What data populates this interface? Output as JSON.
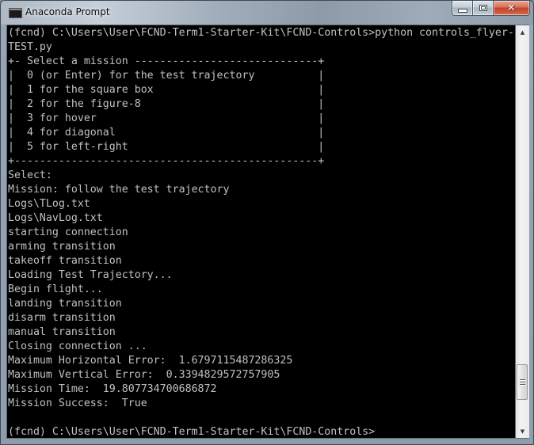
{
  "window": {
    "title": "Anaconda Prompt",
    "icon": "console-icon",
    "buttons": {
      "minimize": "minimize",
      "maximize": "maximize",
      "close": "close",
      "close_glyph": "✕"
    }
  },
  "console": {
    "lines": [
      "(fcnd) C:\\Users\\User\\FCND-Term1-Starter-Kit\\FCND-Controls>python controls_flyer-",
      "TEST.py",
      "+- Select a mission -----------------------------+",
      "|  0 (or Enter) for the test trajectory          |",
      "|  1 for the square box                          |",
      "|  2 for the figure-8                            |",
      "|  3 for hover                                   |",
      "|  4 for diagonal                                |",
      "|  5 for left-right                              |",
      "+------------------------------------------------+",
      "Select:",
      "Mission: follow the test trajectory",
      "Logs\\TLog.txt",
      "Logs\\NavLog.txt",
      "starting connection",
      "arming transition",
      "takeoff transition",
      "Loading Test Trajectory...",
      "Begin flight...",
      "landing transition",
      "disarm transition",
      "manual transition",
      "Closing connection ...",
      "Maximum Horizontal Error:  1.6797115487286325",
      "Maximum Vertical Error:  0.3394829572757905",
      "Mission Time:  19.807734700686872",
      "Mission Success:  True",
      "",
      "(fcnd) C:\\Users\\User\\FCND-Term1-Starter-Kit\\FCND-Controls>"
    ],
    "colors": {
      "background": "#000000",
      "foreground": "#c0c0c0"
    }
  },
  "scrollbar": {
    "up_arrow": "▲",
    "down_arrow": "▼",
    "position_fraction": 0.93
  }
}
